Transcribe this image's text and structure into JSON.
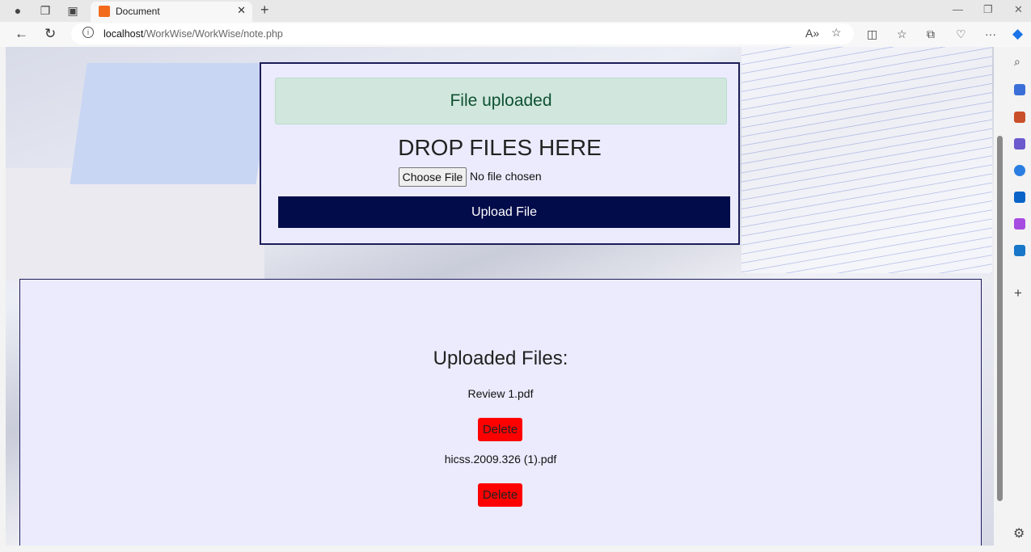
{
  "browser": {
    "tab_title": "Document",
    "url_host": "localhost",
    "url_path": "/WorkWise/WorkWise/note.php"
  },
  "upload_card": {
    "alert": "File uploaded",
    "heading": "DROP FILES HERE",
    "choose_label": "Choose File",
    "no_file": "No file chosen",
    "upload_label": "Upload File"
  },
  "files": {
    "title": "Uploaded Files:",
    "items": [
      {
        "name": "Review 1.pdf",
        "delete_label": "Delete"
      },
      {
        "name": "hicss.2009.326 (1).pdf",
        "delete_label": "Delete"
      }
    ]
  },
  "colors": {
    "upload_button": "#030c4a",
    "delete_button": "#ff0000",
    "alert_bg": "#d1e7dd"
  }
}
